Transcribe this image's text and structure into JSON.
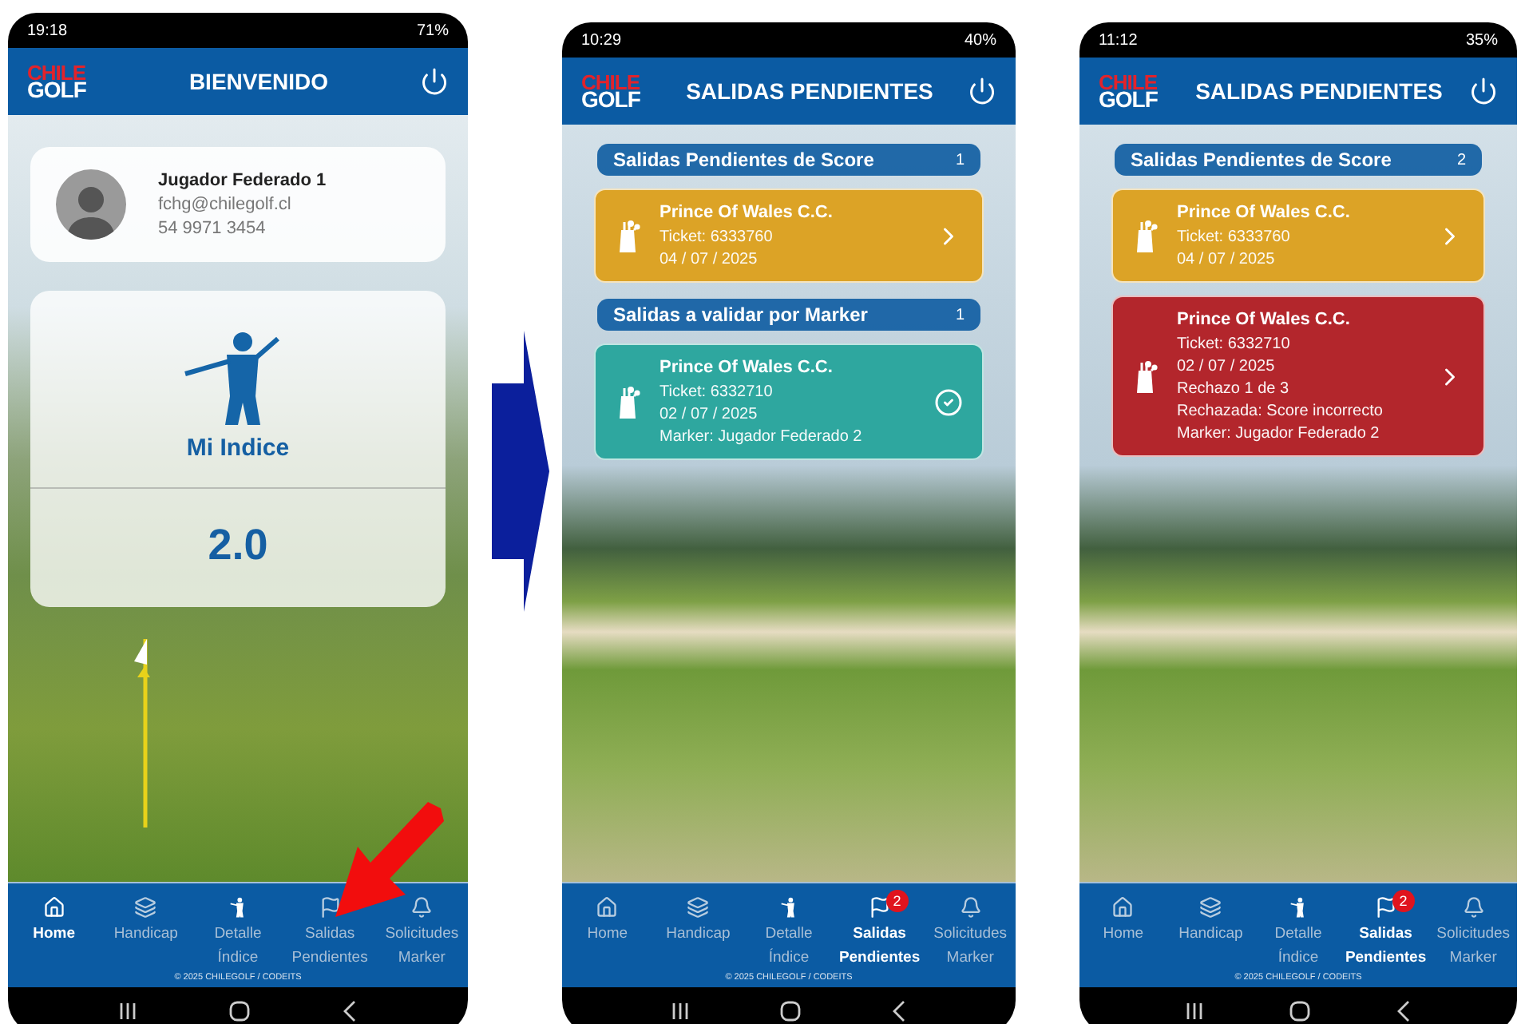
{
  "phones": [
    {
      "kind": "home",
      "status_bar": {
        "time": "19:18",
        "battery": "71%"
      },
      "header": {
        "logo_top": "CHILE",
        "logo_bottom": "GOLF",
        "title": "BIENVENIDO"
      },
      "profile": {
        "name": "Jugador Federado 1",
        "email": "fchg@chilegolf.cl",
        "phone": "54 9971 3454"
      },
      "index_card": {
        "label": "Mi Indice",
        "value": "2.0"
      },
      "nav": [
        {
          "lines": [
            "Home"
          ],
          "selected": true
        },
        {
          "lines": [
            "Handicap"
          ],
          "selected": false
        },
        {
          "lines": [
            "Detalle",
            "Índice"
          ],
          "selected": false
        },
        {
          "lines": [
            "Salidas",
            "Pendientes"
          ],
          "selected": false
        },
        {
          "lines": [
            "Solicitudes",
            "Marker"
          ],
          "selected": false
        }
      ],
      "copyright": "© 2025 CHILEGOLF / CODEITS"
    },
    {
      "kind": "pending",
      "status_bar": {
        "time": "10:29",
        "battery": "40%"
      },
      "header": {
        "logo_top": "CHILE",
        "logo_bottom": "GOLF",
        "title": "SALIDAS PENDIENTES"
      },
      "sections": [
        {
          "title": "Salidas Pendientes de Score",
          "count": "1",
          "cards": [
            {
              "color": "#dca326",
              "title": "Prince Of Wales C.C.",
              "details": [
                "Ticket: 6333760",
                "04 / 07 / 2025"
              ],
              "kind": "score"
            }
          ]
        },
        {
          "title": "Salidas a validar por Marker",
          "count": "1",
          "cards": [
            {
              "color": "#2ea79f",
              "title": "Prince Of Wales C.C.",
              "details": [
                "Ticket: 6332710",
                "02 / 07 / 2025",
                "Marker: Jugador Federado 2"
              ],
              "kind": "marker"
            }
          ]
        }
      ],
      "nav": [
        {
          "lines": [
            "Home"
          ],
          "selected": false
        },
        {
          "lines": [
            "Handicap"
          ],
          "selected": false
        },
        {
          "lines": [
            "Detalle",
            "Índice"
          ],
          "selected": false
        },
        {
          "lines": [
            "Salidas",
            "Pendientes"
          ],
          "selected": true,
          "badge": "2"
        },
        {
          "lines": [
            "Solicitudes",
            "Marker"
          ],
          "selected": false
        }
      ],
      "copyright": "© 2025 CHILEGOLF / CODEITS"
    },
    {
      "kind": "pending",
      "status_bar": {
        "time": "11:12",
        "battery": "35%"
      },
      "header": {
        "logo_top": "CHILE",
        "logo_bottom": "GOLF",
        "title": "SALIDAS PENDIENTES"
      },
      "sections": [
        {
          "title": "Salidas Pendientes de Score",
          "count": "2",
          "cards": [
            {
              "color": "#dca326",
              "title": "Prince Of Wales C.C.",
              "details": [
                "Ticket: 6333760",
                "04 / 07 / 2025"
              ],
              "kind": "score"
            },
            {
              "color": "#b3262c",
              "title": "Prince Of Wales C.C.",
              "details": [
                "Ticket: 6332710",
                "02 / 07 / 2025",
                "Rechazo 1 de 3",
                "Rechazada: Score incorrecto",
                "Marker: Jugador Federado 2"
              ],
              "kind": "score"
            }
          ]
        }
      ],
      "nav": [
        {
          "lines": [
            "Home"
          ],
          "selected": false
        },
        {
          "lines": [
            "Handicap"
          ],
          "selected": false
        },
        {
          "lines": [
            "Detalle",
            "Índice"
          ],
          "selected": false
        },
        {
          "lines": [
            "Salidas",
            "Pendientes"
          ],
          "selected": true,
          "badge": "2"
        },
        {
          "lines": [
            "Solicitudes",
            "Marker"
          ],
          "selected": false
        }
      ],
      "copyright": "© 2025 CHILEGOLF / CODEITS"
    }
  ]
}
